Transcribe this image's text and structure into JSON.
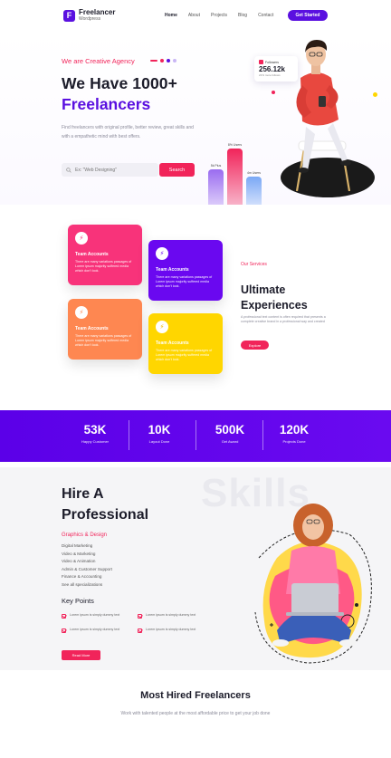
{
  "brand": {
    "name": "Freelancer",
    "tagline": "Wordpress",
    "mark": "F"
  },
  "nav": {
    "items": [
      "Home",
      "About",
      "Projects",
      "Blog",
      "Contact"
    ],
    "cta": "Get Started"
  },
  "hero": {
    "eyebrow": "We are Creative Agency",
    "title_line1": "We Have 1000+",
    "title_line2": "Freelancers",
    "description": "Find freelancers with original profile, better review, great skills and with a empathetic mind with best offers.",
    "search_placeholder": "Ex: \"Web Designing\"",
    "search_button": "Search",
    "stat_card": {
      "label": "Followers",
      "value": "256.12k",
      "sub": "21% more follows"
    },
    "bars": [
      {
        "label": "5k Plus",
        "value": 5,
        "color": "#9a6cf0"
      },
      {
        "label": "8% Users",
        "value": 8,
        "color": "#f1245a"
      },
      {
        "label": "4m Users",
        "value": 4,
        "color": "#7aa8f5"
      }
    ],
    "colors": {
      "accent": "#f1245a",
      "primary": "#5a10e0"
    }
  },
  "services": {
    "label": "Our Services",
    "title_line1": "Ultimate",
    "title_line2": "Experiences",
    "description": "A professional text content is often required that presents a complete creative brand in a professional way and created",
    "button": "Explore",
    "cards": [
      {
        "title": "Team Accounts",
        "desc": "There are many variations passages of Lorem ipsum majority suffered media which don't look.",
        "color": "#f8337a",
        "icon_color": "#f8337a"
      },
      {
        "title": "Team Accounts",
        "desc": "There are many variations passages of Lorem ipsum majority suffered media which don't look.",
        "color": "#6a08f0",
        "icon_color": "#6a08f0"
      },
      {
        "title": "Team Accounts",
        "desc": "There are many variations passages of Lorem ipsum majority suffered media which don't look.",
        "color": "#fe8751",
        "icon_color": "#fe8751"
      },
      {
        "title": "Team Accounts",
        "desc": "There are many variations passages of Lorem ipsum majority suffered media which don't look.",
        "color": "#ffd600",
        "icon_color": "#f5b700"
      }
    ]
  },
  "stats": [
    {
      "value": "53K",
      "label": "Happy Customer"
    },
    {
      "value": "10K",
      "label": "Layout Done"
    },
    {
      "value": "500K",
      "label": "Get Award"
    },
    {
      "value": "120K",
      "label": "Projects Done"
    }
  ],
  "hire": {
    "watermark": "Skills",
    "title_line1": "Hire A",
    "title_line2": "Professional",
    "category": "Graphics & Design",
    "list": [
      "Digital Marketing",
      "Video & Marketing",
      "Video & Animation",
      "Admin & Customer Support",
      "Finance & Accounting",
      "See all specializations"
    ],
    "key_points_title": "Key Points",
    "key_points": [
      "Lorem ipsum is simply dummy text",
      "Lorem ipsum is simply dummy text",
      "Lorem ipsum is simply dummy text",
      "Lorem ipsum is simply dummy text"
    ],
    "button": "Read More"
  },
  "most_hired": {
    "title": "Most Hired Freelancers",
    "subtitle": "Work with talented people at the most affordable price to get your job done"
  }
}
